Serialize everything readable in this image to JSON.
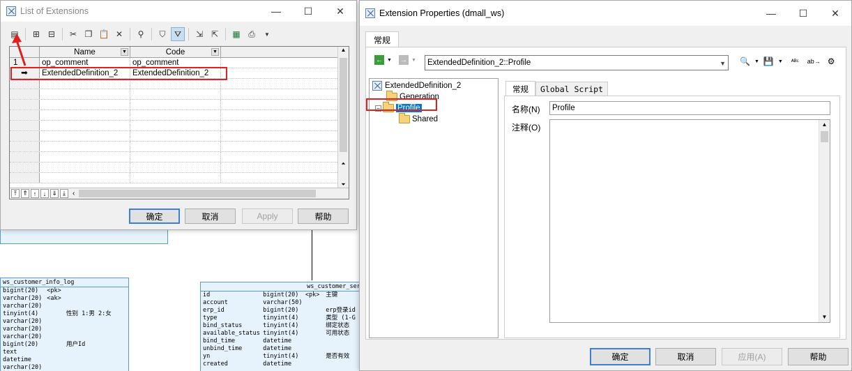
{
  "list_window": {
    "title": "List of Extensions",
    "columns": [
      "Name",
      "Code"
    ],
    "rows": [
      {
        "marker": "1",
        "name": "op_comment",
        "code": "op_comment"
      },
      {
        "marker": "➡",
        "name": "ExtendedDefinition_2",
        "code": "ExtendedDefinition_2"
      }
    ],
    "buttons": {
      "ok": "确定",
      "cancel": "取消",
      "apply": "Apply",
      "help": "帮助"
    }
  },
  "props_window": {
    "title": "Extension Properties (dmall_ws)",
    "top_tab": "常规",
    "path": "ExtendedDefinition_2::Profile",
    "tree": {
      "root": "ExtendedDefinition_2",
      "children": [
        "Generation",
        "Profile"
      ],
      "grandchild": "Shared",
      "selected": "Profile"
    },
    "inner_tabs": [
      "常规",
      "Global Script"
    ],
    "form": {
      "name_label": "名称(N)",
      "name_value": "Profile",
      "comment_label": "注释(O)"
    },
    "buttons": {
      "ok": "确定",
      "cancel": "取消",
      "apply": "应用(A)",
      "help": "帮助"
    }
  },
  "background": {
    "table1": {
      "title": "ws_customer_info_log",
      "rows": [
        [
          "bigint(20)",
          "<pk>",
          ""
        ],
        [
          "varchar(20)",
          "<ak>",
          ""
        ],
        [
          "varchar(20)",
          "",
          ""
        ],
        [
          "tinyint(4)",
          "",
          "性别 1:男 2:女"
        ],
        [
          "varchar(20)",
          "",
          ""
        ],
        [
          "varchar(20)",
          "",
          ""
        ],
        [
          "varchar(20)",
          "",
          ""
        ],
        [
          "bigint(20)",
          "",
          "用户Id"
        ],
        [
          "text",
          "",
          ""
        ],
        [
          "datetime",
          "",
          ""
        ],
        [
          "varchar(20)",
          "",
          ""
        ]
      ]
    },
    "table2": {
      "title": "ws_customer_serv",
      "rows": [
        [
          "id",
          "bigint(20)",
          "<pk>",
          "主键"
        ],
        [
          "account",
          "varchar(50)",
          "",
          ""
        ],
        [
          "erp_id",
          "bigint(20)",
          "",
          "erp登录id"
        ],
        [
          "type",
          "tinyint(4)",
          "",
          "类型 (1-G"
        ],
        [
          "bind_status",
          "tinyint(4)",
          "",
          "绑定状态"
        ],
        [
          "available_status",
          "tinyint(4)",
          "",
          "可用状态"
        ],
        [
          "bind_time",
          "datetime",
          "",
          ""
        ],
        [
          "unbind_time",
          "datetime",
          "",
          ""
        ],
        [
          "yn",
          "tinyint(4)",
          "",
          "是否有效"
        ],
        [
          "created",
          "datetime",
          "",
          ""
        ]
      ]
    }
  }
}
